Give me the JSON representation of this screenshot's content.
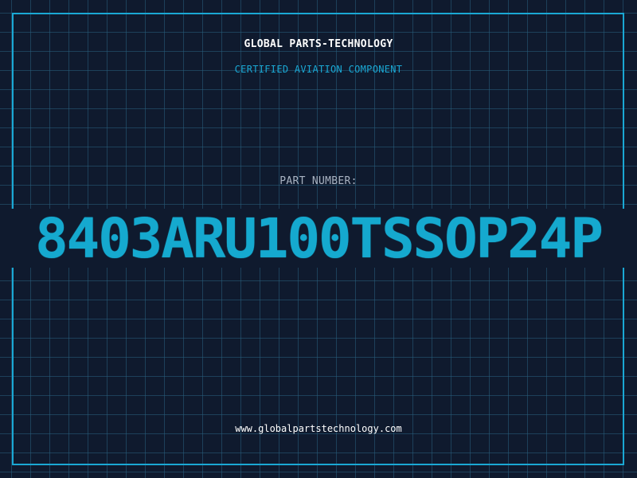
{
  "header": {
    "company": "GLOBAL PARTS-TECHNOLOGY",
    "subtitle": "CERTIFIED AVIATION COMPONENT"
  },
  "part": {
    "label": "PART NUMBER:",
    "number": "8403ARU100TSSOP24P"
  },
  "footer": {
    "website": "www.globalpartstechnology.com"
  },
  "colors": {
    "background": "#0f1a2e",
    "accent": "#1aa8d4",
    "grid": "#285f7d",
    "text": "#ffffff",
    "label": "#a9b3c2"
  }
}
